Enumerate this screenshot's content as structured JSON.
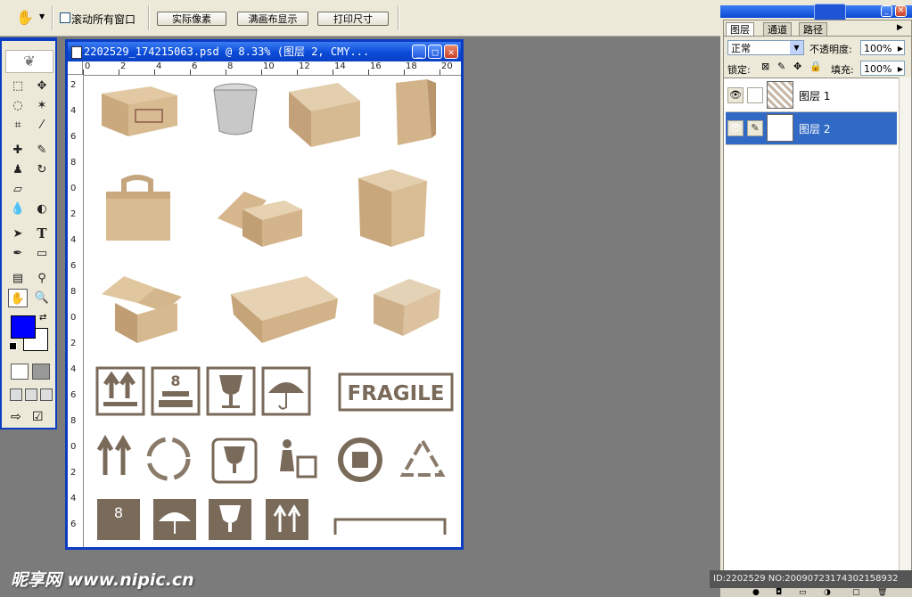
{
  "options_bar": {
    "hand_tool_icon": "hand-icon",
    "scroll_all_windows_label": "滚动所有窗口",
    "buttons": [
      "实际像素",
      "满画布显示",
      "打印尺寸"
    ]
  },
  "toolbox": {
    "tools": [
      "marquee-icon",
      "move-icon",
      "lasso-icon",
      "magic-wand-icon",
      "crop-icon",
      "slice-icon",
      "healing-brush-icon",
      "brush-icon",
      "clone-stamp-icon",
      "history-brush-icon",
      "eraser-icon",
      "gradient-icon",
      "blur-icon",
      "dodge-icon",
      "path-select-icon",
      "type-icon",
      "pen-icon",
      "shape-icon",
      "notes-icon",
      "eyedropper-icon",
      "hand-icon",
      "zoom-icon"
    ],
    "type_glyph": "T",
    "foreground_color": "#0000ff",
    "background_color": "#ffffff"
  },
  "document": {
    "title": "2202529_174215063.psd @ 8.33% (图层 2, CMY...",
    "ruler_h_ticks": [
      "0",
      "2",
      "4",
      "6",
      "8",
      "10",
      "12",
      "14",
      "16",
      "18",
      "20"
    ],
    "ruler_v_ticks": [
      "2",
      "4",
      "6",
      "8",
      "0",
      "2",
      "4",
      "6",
      "8",
      "0",
      "2",
      "4",
      "6",
      "8",
      "0",
      "2",
      "4",
      "6"
    ],
    "fragile_label": "FRAGILE",
    "stamp_label": "FRAGILE",
    "digit_label": "8"
  },
  "layers_panel": {
    "tabs": [
      "图层",
      "通道",
      "路径"
    ],
    "blend_mode": "正常",
    "opacity_label": "不透明度:",
    "opacity_value": "100%",
    "lock_label": "锁定:",
    "fill_label": "填充:",
    "fill_value": "100%",
    "layers": [
      {
        "name": "图层 1",
        "selected": false
      },
      {
        "name": "图层 2",
        "selected": true
      }
    ]
  },
  "watermark": {
    "text": "昵享网 www.nipic.cn",
    "id_text": "ID:2202529 NO:20090723174302158932"
  },
  "colors": {
    "accent": "#0b3cc1",
    "selection": "#316ac5",
    "cardboard": "#c8a97f",
    "icon_brown": "#7a6a5a"
  }
}
